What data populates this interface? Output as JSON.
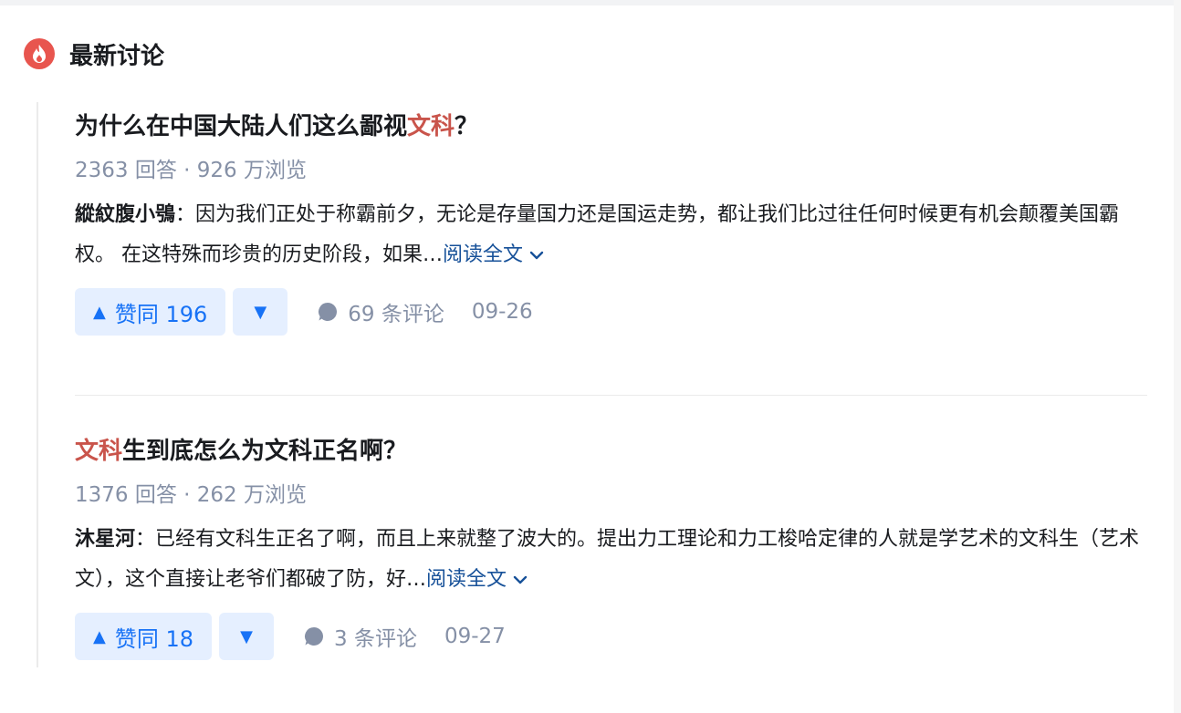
{
  "section": {
    "icon": "fire-icon",
    "title": "最新讨论"
  },
  "colors": {
    "accent": "#1772f6",
    "highlight": "#c9544b",
    "meta": "#8590a6",
    "link": "#175199",
    "badge": "#e8554e"
  },
  "posts": [
    {
      "title_pre": "为什么在中国大陆人们这么鄙视",
      "title_hl": "文科",
      "title_post": "？",
      "meta": "2363 回答 · 926 万浏览",
      "author": "縱紋腹小鴞",
      "excerpt": "：因为我们正处于称霸前夕，无论是存量国力还是国运走势，都让我们比过往任何时候更有机会颠覆美国霸权。 在这特殊而珍贵的历史阶段，如果…",
      "read_more": "阅读全文",
      "vote_label": "赞同 196",
      "comments": "69 条评论",
      "date": "09-26"
    },
    {
      "title_pre": "",
      "title_hl": "文科",
      "title_post": "生到底怎么为文科正名啊？",
      "meta": "1376 回答 · 262 万浏览",
      "author": "沐星河",
      "excerpt": "：已经有文科生正名了啊，而且上来就整了波大的。提出力工理论和力工梭哈定律的人就是学艺术的文科生（艺术文），这个直接让老爷们都破了防，好…",
      "read_more": "阅读全文",
      "vote_label": "赞同 18",
      "comments": "3 条评论",
      "date": "09-27"
    }
  ]
}
